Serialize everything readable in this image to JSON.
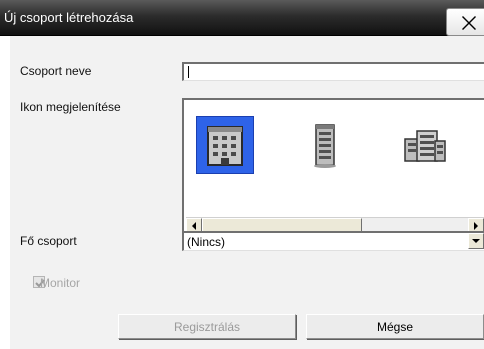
{
  "window": {
    "title": "Új csoport létrehozása",
    "close_icon": "close-icon"
  },
  "form": {
    "group_name_label": "Csoport neve",
    "group_name_value": "",
    "icon_display_label": "Ikon megjelenítése",
    "icons": [
      {
        "name": "building-icon",
        "selected": true
      },
      {
        "name": "tower-icon",
        "selected": false
      },
      {
        "name": "office-building-icon",
        "selected": false
      }
    ],
    "main_group_label": "Fő csoport",
    "main_group_value": "(Nincs)",
    "monitor_label": "Monitor",
    "monitor_checked": true,
    "monitor_enabled": false
  },
  "buttons": {
    "register_label": "Regisztrálás",
    "register_enabled": false,
    "cancel_label": "Mégse"
  }
}
